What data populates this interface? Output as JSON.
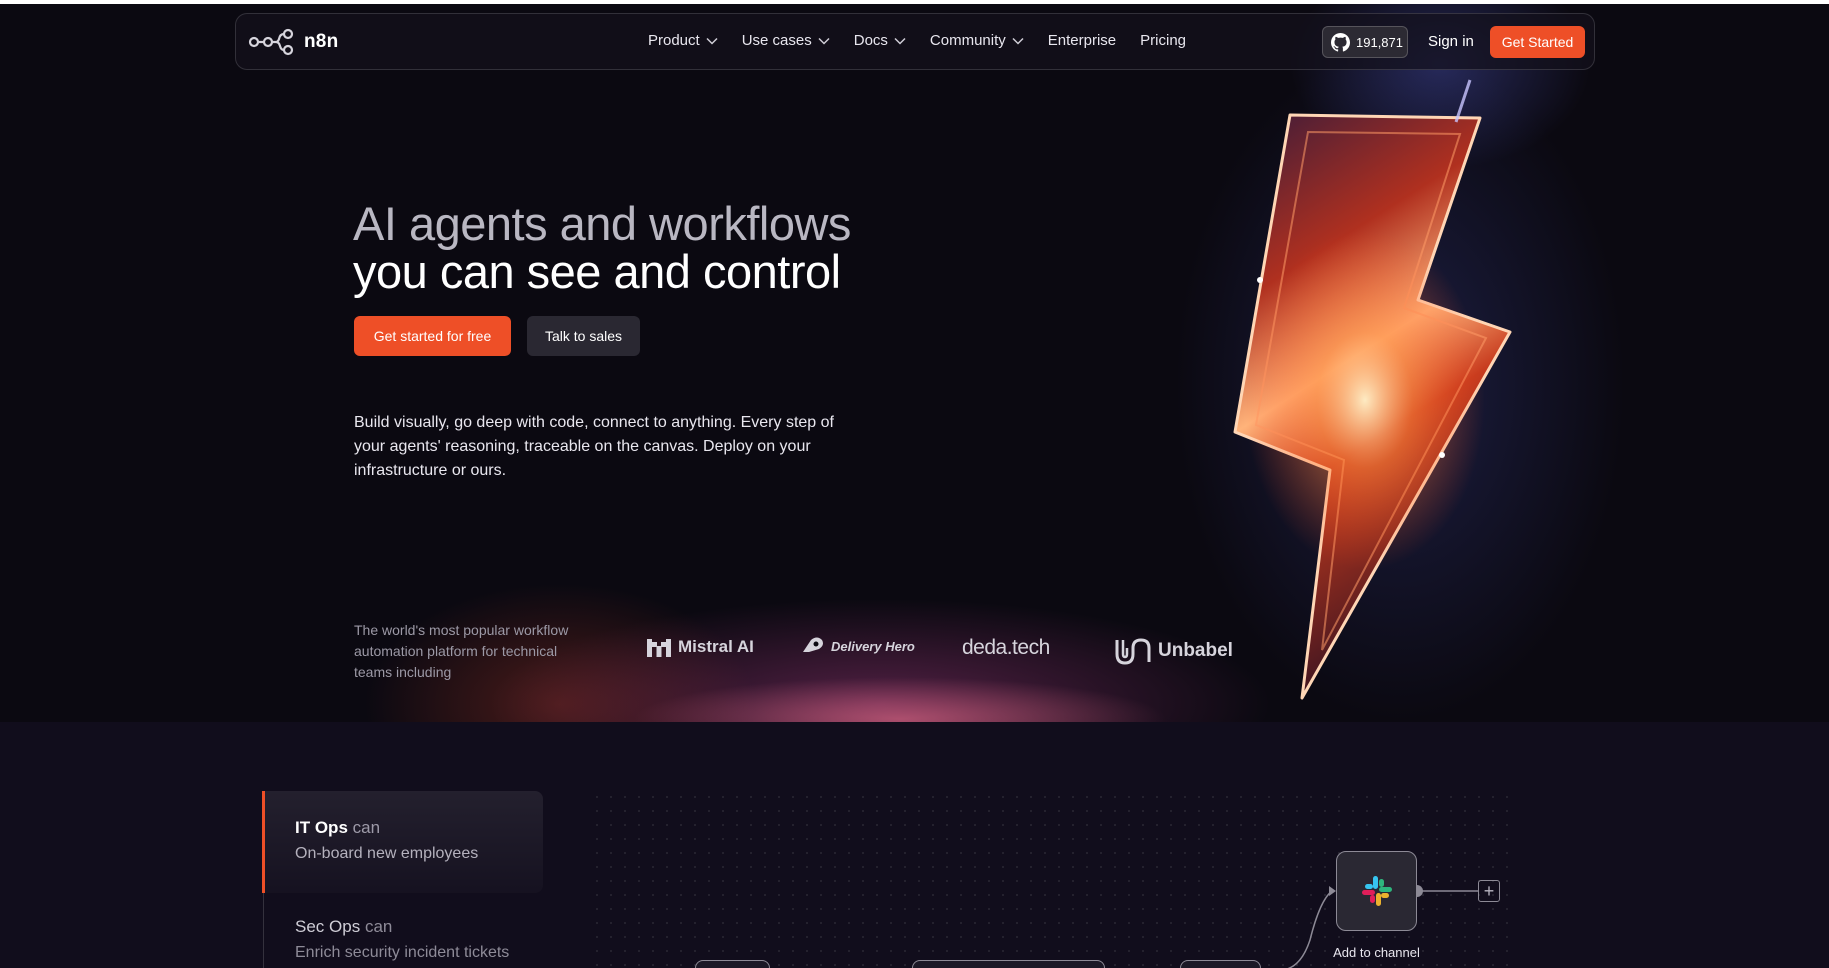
{
  "brand": {
    "name": "n8n",
    "accent": "#ee4f27"
  },
  "nav": {
    "items": [
      {
        "label": "Product",
        "has_dropdown": true
      },
      {
        "label": "Use cases",
        "has_dropdown": true
      },
      {
        "label": "Docs",
        "has_dropdown": true
      },
      {
        "label": "Community",
        "has_dropdown": true
      },
      {
        "label": "Enterprise",
        "has_dropdown": false
      },
      {
        "label": "Pricing",
        "has_dropdown": false
      }
    ],
    "github_stars": "191,871",
    "github_icon": "github-icon",
    "sign_in": "Sign in",
    "get_started": "Get Started"
  },
  "hero": {
    "headline_line1": "AI agents and workflows",
    "headline_line2": "you can see and control",
    "cta_primary": "Get started for free",
    "cta_secondary": "Talk to sales",
    "description": "Build visually, go deep with code, connect to anything. Every step of your agents' reasoning, traceable on the canvas. Deploy on your infrastructure or ours."
  },
  "trusted": {
    "text": "The world's most popular workflow automation platform for technical teams including",
    "logos": [
      "Mistral AI",
      "Delivery Hero",
      "deda.tech",
      "Unbabel"
    ]
  },
  "use_cases": {
    "tabs": [
      {
        "team": "IT Ops",
        "verb": "can",
        "task": "On-board new employees",
        "active": true
      },
      {
        "team": "Sec Ops",
        "verb": "can",
        "task": "Enrich security incident tickets",
        "active": false
      }
    ]
  },
  "workflow": {
    "node_label": "Add to channel",
    "node_icon": "slack-icon",
    "add_icon": "plus-icon"
  }
}
